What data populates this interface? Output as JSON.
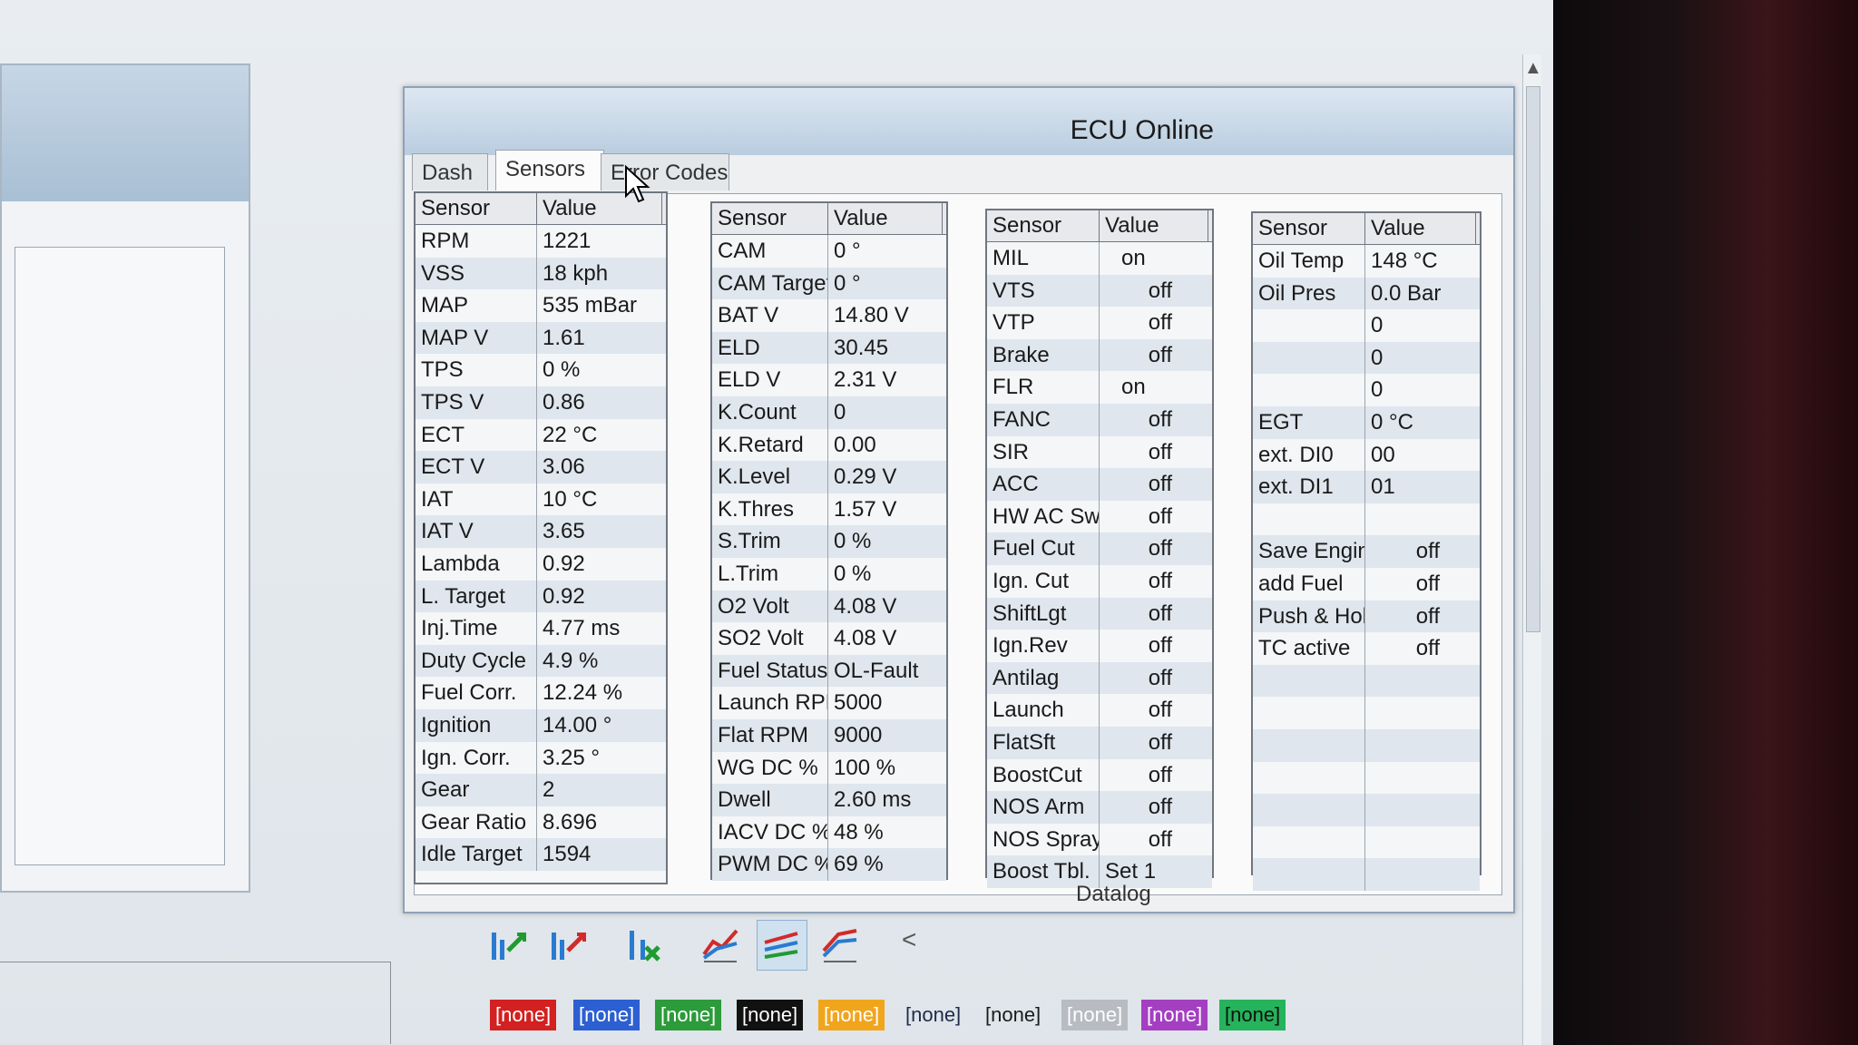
{
  "window": {
    "title": "ECU Online"
  },
  "tabs": [
    {
      "label": "Dash",
      "active": false
    },
    {
      "label": "Sensors",
      "active": true
    },
    {
      "label": "Error Codes",
      "active": false
    }
  ],
  "tables": [
    {
      "header": {
        "sensor": "Sensor",
        "value": "Value"
      },
      "rows": [
        {
          "sensor": "RPM",
          "value": "1221"
        },
        {
          "sensor": "VSS",
          "value": "18 kph"
        },
        {
          "sensor": "MAP",
          "value": "535 mBar"
        },
        {
          "sensor": "MAP V",
          "value": "1.61"
        },
        {
          "sensor": "TPS",
          "value": "0 %"
        },
        {
          "sensor": "TPS V",
          "value": "0.86"
        },
        {
          "sensor": "ECT",
          "value": "22 °C"
        },
        {
          "sensor": "ECT V",
          "value": "3.06"
        },
        {
          "sensor": "IAT",
          "value": "10 °C"
        },
        {
          "sensor": "IAT V",
          "value": "3.65"
        },
        {
          "sensor": "Lambda",
          "value": "0.92"
        },
        {
          "sensor": "L. Target",
          "value": "0.92"
        },
        {
          "sensor": "Inj.Time",
          "value": "4.77 ms"
        },
        {
          "sensor": "Duty Cycle",
          "value": "4.9 %"
        },
        {
          "sensor": "Fuel Corr.",
          "value": "12.24 %"
        },
        {
          "sensor": "Ignition",
          "value": "14.00 °"
        },
        {
          "sensor": "Ign. Corr.",
          "value": "3.25 °"
        },
        {
          "sensor": "Gear",
          "value": "2"
        },
        {
          "sensor": "Gear Ratio",
          "value": "8.696"
        },
        {
          "sensor": "Idle Target",
          "value": "1594"
        }
      ]
    },
    {
      "header": {
        "sensor": "Sensor",
        "value": "Value"
      },
      "rows": [
        {
          "sensor": "CAM",
          "value": "0 °"
        },
        {
          "sensor": "CAM Target",
          "value": "0 °"
        },
        {
          "sensor": "BAT V",
          "value": "14.80 V"
        },
        {
          "sensor": "ELD",
          "value": "30.45"
        },
        {
          "sensor": "ELD V",
          "value": "2.31 V"
        },
        {
          "sensor": "K.Count",
          "value": "0"
        },
        {
          "sensor": "K.Retard",
          "value": "0.00"
        },
        {
          "sensor": "K.Level",
          "value": "0.29 V"
        },
        {
          "sensor": "K.Thres",
          "value": "1.57 V"
        },
        {
          "sensor": "S.Trim",
          "value": "0 %"
        },
        {
          "sensor": "L.Trim",
          "value": "0 %"
        },
        {
          "sensor": "O2 Volt",
          "value": "4.08 V"
        },
        {
          "sensor": "SO2 Volt",
          "value": "4.08 V"
        },
        {
          "sensor": "Fuel Status",
          "value": "OL-Fault"
        },
        {
          "sensor": "Launch RPM",
          "value": "5000"
        },
        {
          "sensor": "Flat RPM",
          "value": "9000"
        },
        {
          "sensor": "WG DC %",
          "value": "100 %"
        },
        {
          "sensor": "Dwell",
          "value": "2.60 ms"
        },
        {
          "sensor": "IACV DC %",
          "value": "48 %"
        },
        {
          "sensor": "PWM DC %",
          "value": "69 %"
        }
      ]
    },
    {
      "header": {
        "sensor": "Sensor",
        "value": "Value"
      },
      "rows": [
        {
          "sensor": "MIL",
          "value": "on"
        },
        {
          "sensor": "VTS",
          "value": "off"
        },
        {
          "sensor": "VTP",
          "value": "off"
        },
        {
          "sensor": "Brake",
          "value": "off"
        },
        {
          "sensor": "FLR",
          "value": "on"
        },
        {
          "sensor": "FANC",
          "value": "off"
        },
        {
          "sensor": "SIR",
          "value": "off"
        },
        {
          "sensor": "ACC",
          "value": "off"
        },
        {
          "sensor": "HW AC Sw",
          "value": "off"
        },
        {
          "sensor": "Fuel Cut",
          "value": "off"
        },
        {
          "sensor": "Ign. Cut",
          "value": "off"
        },
        {
          "sensor": "ShiftLgt",
          "value": "off"
        },
        {
          "sensor": "Ign.Rev",
          "value": "off"
        },
        {
          "sensor": "Antilag",
          "value": "off"
        },
        {
          "sensor": "Launch",
          "value": "off"
        },
        {
          "sensor": "FlatSft",
          "value": "off"
        },
        {
          "sensor": "BoostCut",
          "value": "off"
        },
        {
          "sensor": "NOS Arm",
          "value": "off"
        },
        {
          "sensor": "NOS Spray",
          "value": "off"
        },
        {
          "sensor": "Boost Tbl.",
          "value": "Set 1"
        }
      ]
    },
    {
      "header": {
        "sensor": "Sensor",
        "value": "Value"
      },
      "rows": [
        {
          "sensor": "Oil Temp",
          "value": "148 °C"
        },
        {
          "sensor": "Oil Pres",
          "value": "0.0 Bar"
        },
        {
          "sensor": "",
          "value": "0"
        },
        {
          "sensor": "",
          "value": "0"
        },
        {
          "sensor": "",
          "value": "0"
        },
        {
          "sensor": "EGT",
          "value": "0 °C"
        },
        {
          "sensor": "ext. DI0",
          "value": "00"
        },
        {
          "sensor": "ext. DI1",
          "value": "01"
        },
        {
          "sensor": "",
          "value": ""
        },
        {
          "sensor": "Save Engine",
          "value": "off"
        },
        {
          "sensor": "add Fuel",
          "value": "off"
        },
        {
          "sensor": "Push & Hold",
          "value": "off"
        },
        {
          "sensor": "TC active",
          "value": "off"
        },
        {
          "sensor": "",
          "value": ""
        },
        {
          "sensor": "",
          "value": ""
        },
        {
          "sensor": "",
          "value": ""
        },
        {
          "sensor": "",
          "value": ""
        },
        {
          "sensor": "",
          "value": ""
        },
        {
          "sensor": "",
          "value": ""
        },
        {
          "sensor": "",
          "value": ""
        }
      ]
    }
  ],
  "datalog": {
    "label": "Datalog",
    "toolbar": [
      {
        "icon": "chart-add-icon",
        "pressed": false
      },
      {
        "icon": "chart-remove-icon",
        "pressed": false
      },
      {
        "icon": "chart-clear-icon",
        "pressed": false
      },
      {
        "icon": "graph-1-icon",
        "pressed": false
      },
      {
        "icon": "graph-2-icon",
        "pressed": true
      },
      {
        "icon": "graph-3-icon",
        "pressed": false
      }
    ],
    "chevron": "<",
    "channels": [
      {
        "label": "[none]",
        "bg": "#d32020",
        "fg": "#ffffff"
      },
      {
        "label": "[none]",
        "bg": "#2c5fd1",
        "fg": "#ffffff"
      },
      {
        "label": "[none]",
        "bg": "#2c9b3a",
        "fg": "#ffffff"
      },
      {
        "label": "[none]",
        "bg": "#111111",
        "fg": "#ffffff"
      },
      {
        "label": "[none]",
        "bg": "#f1a51d",
        "fg": "#ffffff"
      },
      {
        "label": "[none]",
        "bg": "transparent",
        "fg": "#1e2b4a"
      },
      {
        "label": "[none]",
        "bg": "transparent",
        "fg": "#1a1a1a"
      },
      {
        "label": "[none]",
        "bg": "#b8bcc2",
        "fg": "#ffffff"
      },
      {
        "label": "[none]",
        "bg": "#a43fc2",
        "fg": "#ffffff"
      },
      {
        "label": "[none]",
        "bg": "#25b35c",
        "fg": "#111111"
      }
    ]
  }
}
